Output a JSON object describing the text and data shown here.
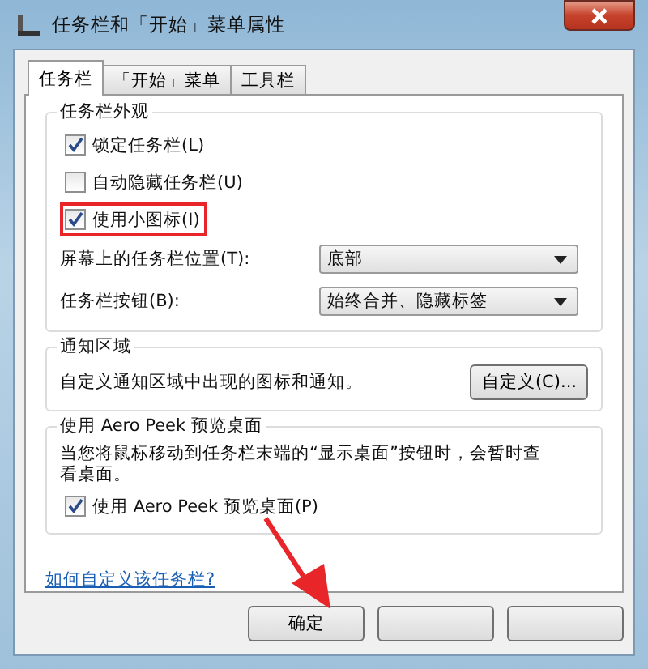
{
  "window": {
    "title": "任务栏和「开始」菜单属性"
  },
  "tabs": [
    {
      "label": "任务栏",
      "selected": true
    },
    {
      "label": "「开始」菜单",
      "selected": false
    },
    {
      "label": "工具栏",
      "selected": false
    }
  ],
  "appearance": {
    "title": "任务栏外观",
    "checkboxes": [
      {
        "label": "锁定任务栏(L)",
        "checked": true,
        "highlighted": false
      },
      {
        "label": "自动隐藏任务栏(U)",
        "checked": false,
        "highlighted": false
      },
      {
        "label": "使用小图标(I)",
        "checked": true,
        "highlighted": true
      }
    ],
    "dropdowns": [
      {
        "label": "屏幕上的任务栏位置(T):",
        "value": "底部"
      },
      {
        "label": "任务栏按钮(B):",
        "value": "始终合并、隐藏标签"
      }
    ]
  },
  "notification": {
    "title": "通知区域",
    "text": "自定义通知区域中出现的图标和通知。",
    "button": "自定义(C)..."
  },
  "aero_peek": {
    "title": "使用 Aero Peek 预览桌面",
    "text": "当您将鼠标移动到任务栏末端的“显示桌面”按钮时，会暂时查看桌面。",
    "checkbox": {
      "label": "使用 Aero Peek 预览桌面(P)",
      "checked": true
    }
  },
  "link": "如何自定义该任务栏?",
  "buttons": [
    {
      "kind": "text",
      "label": "确定"
    },
    {
      "kind": "blank"
    },
    {
      "kind": "blank"
    }
  ],
  "annotation_arrow": true
}
